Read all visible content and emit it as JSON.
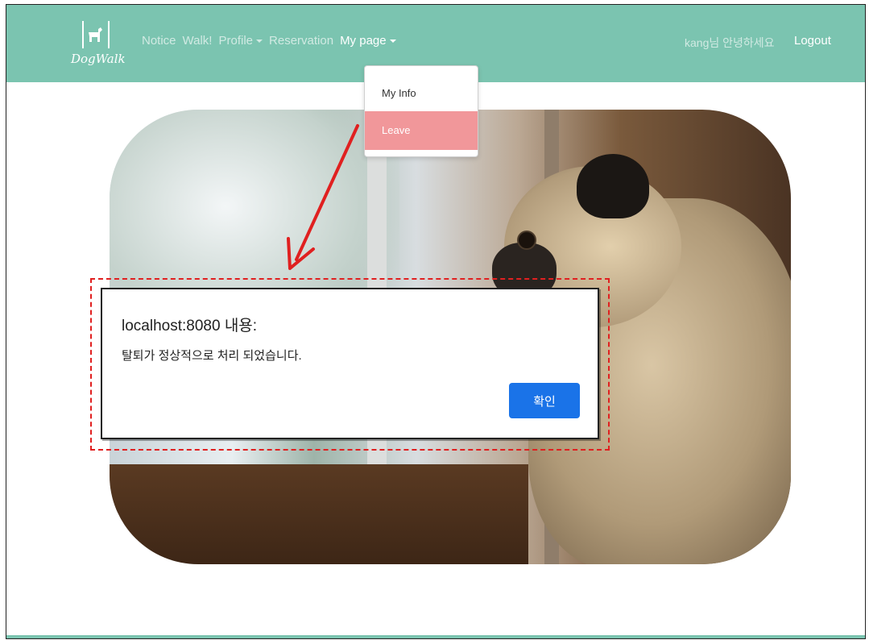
{
  "brand": {
    "name": "DogWalk",
    "logo_icon": "dog-icon"
  },
  "nav": {
    "links": [
      {
        "label": "Notice",
        "dropdown": false
      },
      {
        "label": "Walk!",
        "dropdown": false
      },
      {
        "label": "Profile",
        "dropdown": true
      },
      {
        "label": "Reservation",
        "dropdown": false
      },
      {
        "label": "My page",
        "dropdown": true,
        "active": true
      }
    ],
    "greeting": "kang님 안녕하세요",
    "logout": "Logout"
  },
  "dropdown": {
    "items": [
      {
        "label": "My Info"
      },
      {
        "label": "Leave",
        "highlighted": true
      }
    ]
  },
  "dialog": {
    "title": "localhost:8080 내용:",
    "message": "탈퇴가 정상적으로 처리 되었습니다.",
    "ok_label": "확인"
  },
  "colors": {
    "navbar": "#7bc4b0",
    "dropdown_highlight": "#f1979a",
    "ok_button": "#1a73e8",
    "annotation": "#e02020"
  }
}
